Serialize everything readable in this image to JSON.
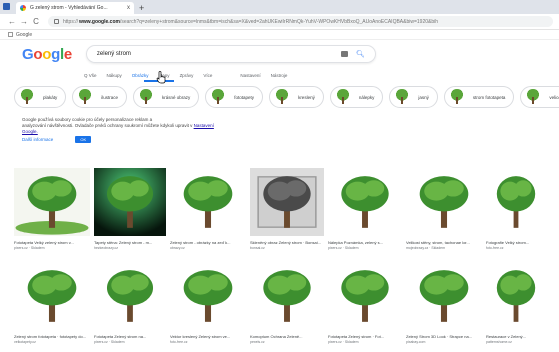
{
  "browser": {
    "tab_title": "G zelený strom - Vyhledávání Go...",
    "tab_close": "x",
    "new_tab": "+",
    "back": "←",
    "forward": "→",
    "reload": "C",
    "url_prefix": "https://",
    "url_host": "www.google.com",
    "url_rest": "/search?q=zeleny+strom&source=lnms&tbm=isch&sa=X&ved=2ahUKEwiIrRNmQk-YuhV-WPOwKHVbBxoQ_AUoAnoECAIQBA&biw=1920&bih",
    "bookmark": "Google"
  },
  "google": {
    "logo": [
      "G",
      "o",
      "o",
      "g",
      "l",
      "e"
    ],
    "query": "zelený strom",
    "tabs": [
      "Q Vše",
      "Nákupy",
      "Obrázky",
      "Mapy",
      "Zprávy",
      "Více",
      "Nastavení",
      "Nástroje"
    ],
    "active_tab_index": 2
  },
  "chips": [
    "plakáty",
    "ilustrace",
    "krásné obrazy",
    "fototapety",
    "kreslený",
    "nálepky",
    "jasný",
    "strom fototapeta",
    "velice"
  ],
  "cookie": {
    "text1": "Google používá soubory cookie pro účely personalizace reklam a",
    "text2": "analyzování návštěvnosti. Ovladače prvků ochrany soukromí můžete kdykoli upravit v",
    "link": "Nastavení",
    "link2": "Google.",
    "more": "Další informace",
    "ok": "OK"
  },
  "results_row1": [
    {
      "caption": "Fototapeta Velký zelený strom v...",
      "source": "pixers.cz · Skladem"
    },
    {
      "caption": "Tapety stěna: Zelený strom - m...",
      "source": "hezkeobrazy.cz"
    },
    {
      "caption": "Zelený strom - obrázky na zeď k...",
      "source": "obrazy.cz"
    },
    {
      "caption": "Skleněný obraz Zelený strom · Bonsai...",
      "source": "bonsai.cz"
    },
    {
      "caption": "Nálepka Poznámka, zelený s...",
      "source": "pixers.cz · Skladem"
    },
    {
      "caption": "Velikost stěny, strom, tachonae lor...",
      "source": "mojeobrazy.cz · Skladem"
    },
    {
      "caption": "Fotografie Velký strom...",
      "source": "foto-free.cz"
    }
  ],
  "results_row2": [
    {
      "caption": "Zelený strom fototapeta · fototapety do...",
      "source": "velkotapety.cz"
    },
    {
      "caption": "Fototapeta Zelený strom na...",
      "source": "pixers.cz · Skladem"
    },
    {
      "caption": "Vektor kreslený Zelený strom ve...",
      "source": "foto-free.cz"
    },
    {
      "caption": "Komoptum Ochrana Zeleně...",
      "source": "pexels.cz"
    },
    {
      "caption": "Fototapeta Zelený strom · Fot...",
      "source": "pixers.cz · Skladem"
    },
    {
      "caption": "Zelený Strom 3D Look · Strapce na...",
      "source": "pixabay.com"
    },
    {
      "caption": "Restaurace v Zelený...",
      "source": "patternshome.cz"
    }
  ],
  "colors": {
    "accent": "#1a73e8",
    "link": "#1a0dab"
  }
}
